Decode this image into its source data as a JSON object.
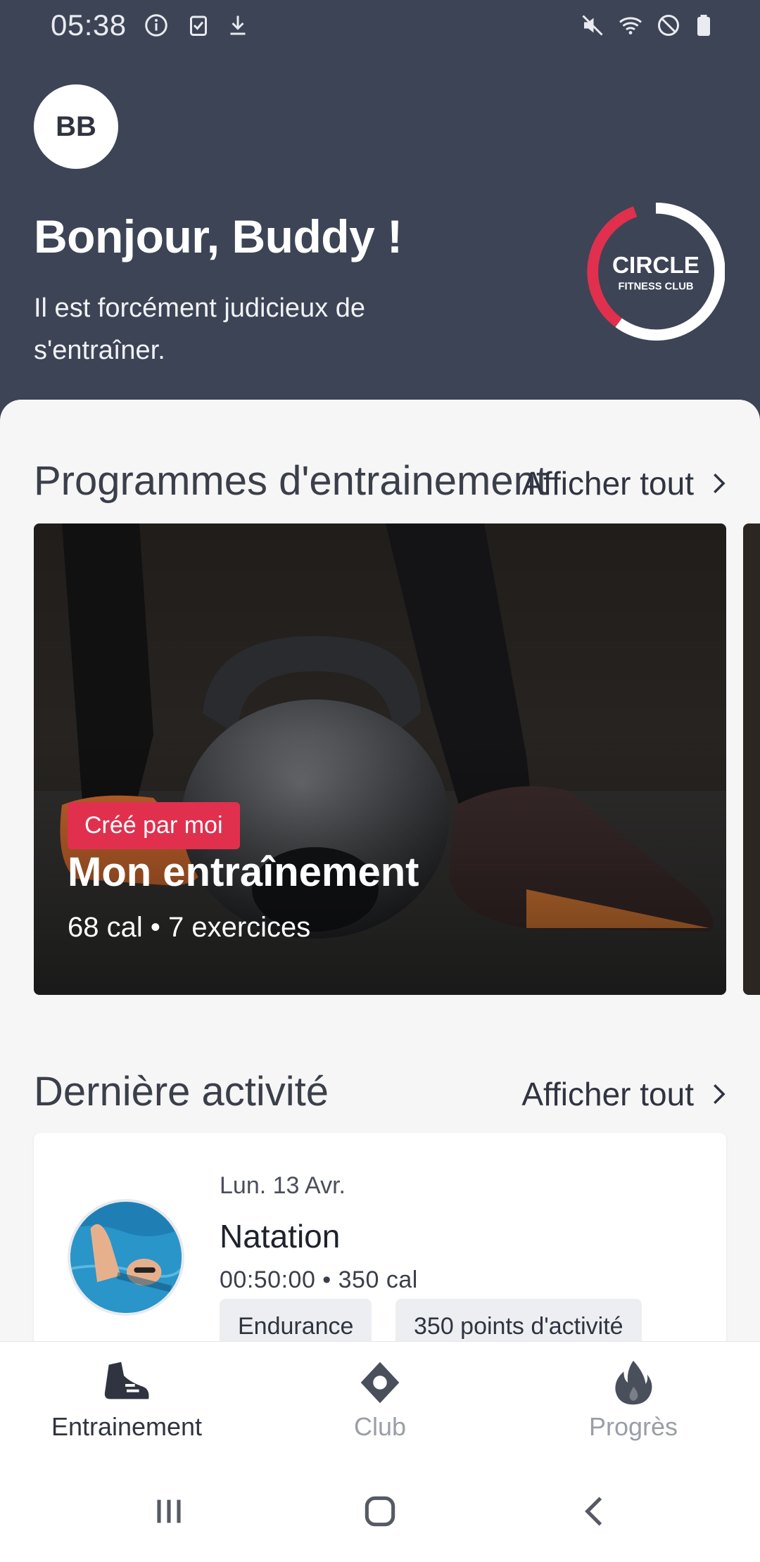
{
  "status_bar": {
    "time": "05:38",
    "left_icons": [
      "info-icon",
      "clipboard-check-icon",
      "download-icon"
    ],
    "right_icons": [
      "mute-icon",
      "wifi-icon",
      "do-not-disturb-icon",
      "battery-icon"
    ]
  },
  "header": {
    "avatar_initials": "BB",
    "greeting": "Bonjour, Buddy !",
    "subtitle": "Il est forcément judicieux de s'entraîner.",
    "logo": {
      "line1": "CIRCLE",
      "line2": "FITNESS CLUB",
      "accent": "#e0304e"
    }
  },
  "programs": {
    "section_title": "Programmes d'entrainement",
    "see_all": "Afficher tout",
    "card": {
      "badge": "Créé par moi",
      "title": "Mon entraînement",
      "meta": "68 cal • 7 exercices"
    }
  },
  "activity": {
    "section_title": "Dernière activité",
    "see_all": "Afficher tout",
    "item": {
      "date": "Lun. 13 Avr.",
      "title": "Natation",
      "meta": "00:50:00 • 350 cal",
      "tags": [
        "Endurance",
        "350 points d'activité"
      ]
    }
  },
  "bottom_nav": {
    "items": [
      {
        "label": "Entrainement",
        "icon": "sneaker-icon",
        "active": true
      },
      {
        "label": "Club",
        "icon": "location-pin-icon",
        "active": false
      },
      {
        "label": "Progrès",
        "icon": "flame-icon",
        "active": false
      }
    ]
  },
  "colors": {
    "header_bg": "#3d4456",
    "accent": "#e0304e",
    "sheet_bg": "#f6f6f7"
  }
}
